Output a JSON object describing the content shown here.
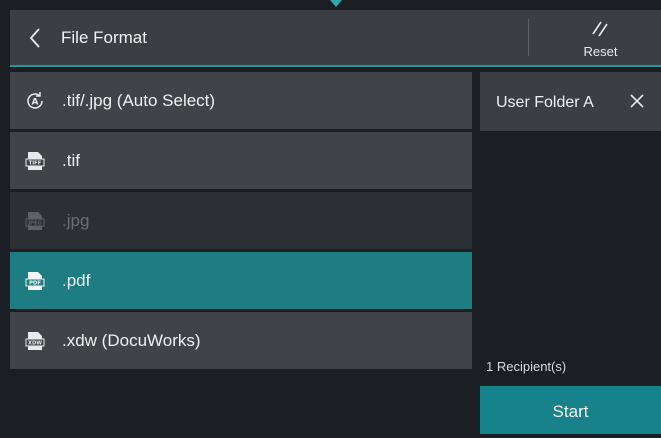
{
  "header": {
    "title": "File Format",
    "reset_label": "Reset"
  },
  "formats": [
    {
      "label": ".tif/.jpg (Auto Select)",
      "icon": "auto-select-icon",
      "state": "normal"
    },
    {
      "label": ".tif",
      "icon": "tiff-file-icon",
      "state": "normal"
    },
    {
      "label": ".jpg",
      "icon": "jpeg-file-icon",
      "state": "disabled"
    },
    {
      "label": ".pdf",
      "icon": "pdf-file-icon",
      "state": "selected"
    },
    {
      "label": ".xdw (DocuWorks)",
      "icon": "xdw-file-icon",
      "state": "normal"
    }
  ],
  "recipients_panel": {
    "recipient": "User Folder A",
    "count": "1 Recipient(s)",
    "start_label": "Start"
  },
  "colors": {
    "accent": "#1a99a4",
    "selected": "#1e7d82",
    "start": "#17828a"
  }
}
